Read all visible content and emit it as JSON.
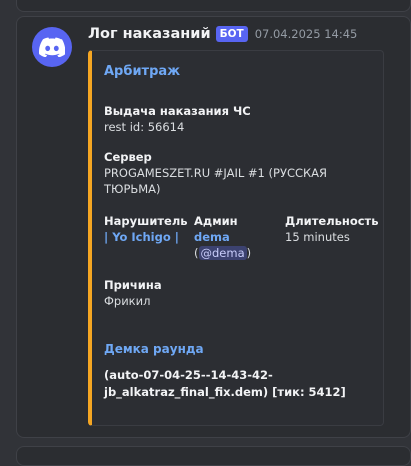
{
  "message": {
    "author": "Лог наказаний",
    "bot_tag": "БОТ",
    "timestamp": "07.04.2025 14:45"
  },
  "embed": {
    "accent_color": "#f5a623",
    "title": "Арбитраж",
    "fields": {
      "action": {
        "name": "Выдача наказания ЧС",
        "value": "rest id: 56614"
      },
      "server": {
        "name": "Сервер",
        "value": "PROGAMESZET.RU #JAIL #1 (РУССКАЯ ТЮРЬМА)"
      },
      "offender": {
        "name": "Нарушитель",
        "value": "| Yo Ichigo |"
      },
      "admin": {
        "name": "Админ",
        "value": "dema",
        "paren_open": "(",
        "mention": "@dema",
        "paren_close": ")"
      },
      "duration": {
        "name": "Длительность",
        "value": "15 minutes"
      },
      "reason": {
        "name": "Причина",
        "value": "Фрикил"
      }
    },
    "demo": {
      "title": "Демка раунда",
      "text": "(auto-07-04-25--14-43-42-jb_alkatraz_final_fix.dem) [тик: 5412]"
    }
  },
  "icons": {
    "avatar": "discord-logo-icon"
  },
  "colors": {
    "background": "#313338",
    "card": "#2b2d31",
    "bot_tag": "#5865f2",
    "link": "#6fa8f5"
  }
}
